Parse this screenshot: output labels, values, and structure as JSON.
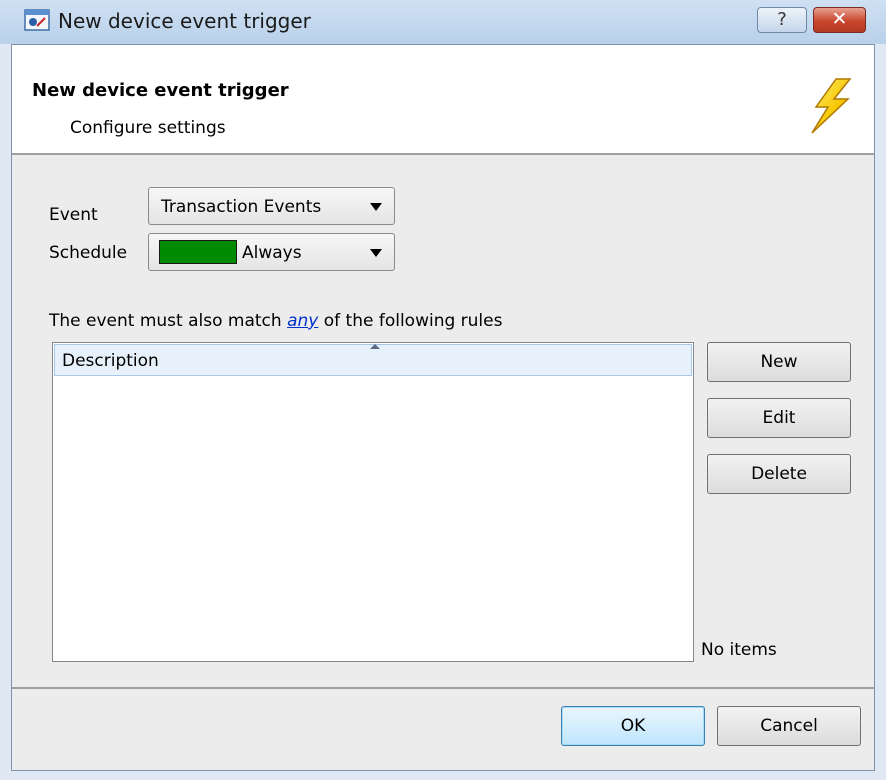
{
  "window": {
    "title": "New device event trigger",
    "help_glyph": "?",
    "close_glyph": "✕"
  },
  "header": {
    "title": "New device event trigger",
    "subtitle": "Configure settings",
    "icon": "lightning-bolt-icon"
  },
  "form": {
    "event_label": "Event",
    "event_value": "Transaction Events",
    "schedule_label": "Schedule",
    "schedule_value": "Always",
    "schedule_color": "#008a00"
  },
  "rules": {
    "text_before": "The event must also match ",
    "link": "any",
    "text_after": " of the following rules",
    "column_header": "Description",
    "items": [],
    "status": "No items"
  },
  "buttons": {
    "new": "New",
    "edit": "Edit",
    "delete": "Delete",
    "ok": "OK",
    "cancel": "Cancel"
  }
}
